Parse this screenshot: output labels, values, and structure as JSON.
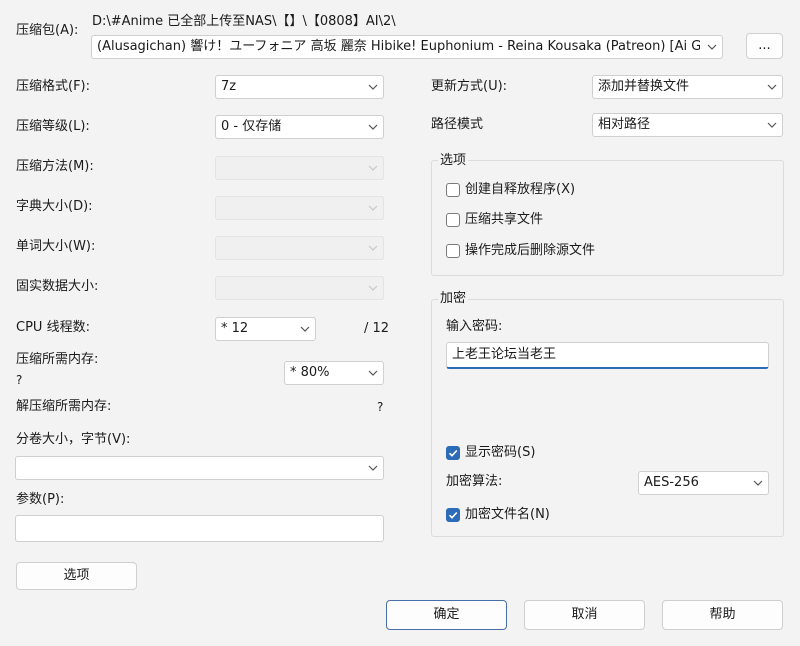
{
  "archive": {
    "label": "压缩包(A):",
    "path": "D:\\#Anime 已全部上传至NAS\\【】\\【0808】AI\\2\\",
    "name": "(Alusagichan) 響け！ユーフォニア 高坂 麗奈 Hibike! Euphonium - Reina Kousaka (Patreon) [Ai Genera",
    "browse_label": "..."
  },
  "left": {
    "format": {
      "label": "压缩格式(F):",
      "value": "7z"
    },
    "level": {
      "label": "压缩等级(L):",
      "value": "0 - 仅存储"
    },
    "method": {
      "label": "压缩方法(M):",
      "value": ""
    },
    "dict": {
      "label": "字典大小(D):",
      "value": ""
    },
    "word": {
      "label": "单词大小(W):",
      "value": ""
    },
    "solid": {
      "label": "固实数据大小:",
      "value": ""
    },
    "threads": {
      "label": "CPU 线程数:",
      "value": "* 12",
      "total": "/ 12"
    },
    "mem_comp": {
      "label": "压缩所需内存:",
      "value": "* 80%",
      "qmark": "?"
    },
    "mem_decomp": {
      "label": "解压缩所需内存:",
      "qmark": "?"
    },
    "volume": {
      "label": "分卷大小，字节(V):",
      "value": ""
    },
    "params": {
      "label": "参数(P):",
      "value": ""
    },
    "options_button": "选项"
  },
  "right": {
    "update": {
      "label": "更新方式(U):",
      "value": "添加并替换文件"
    },
    "pathmode": {
      "label": "路径模式",
      "value": "相对路径"
    },
    "options": {
      "title": "选项",
      "sfx": "创建自释放程序(X)",
      "shared": "压缩共享文件",
      "delete": "操作完成后删除源文件"
    },
    "encrypt": {
      "title": "加密",
      "pw_label": "输入密码:",
      "pw_value": "上老王论坛当老王",
      "show_pw": "显示密码(S)",
      "algo_label": "加密算法:",
      "algo_value": "AES-256",
      "enc_names": "加密文件名(N)"
    }
  },
  "buttons": {
    "ok": "确定",
    "cancel": "取消",
    "help": "帮助"
  }
}
